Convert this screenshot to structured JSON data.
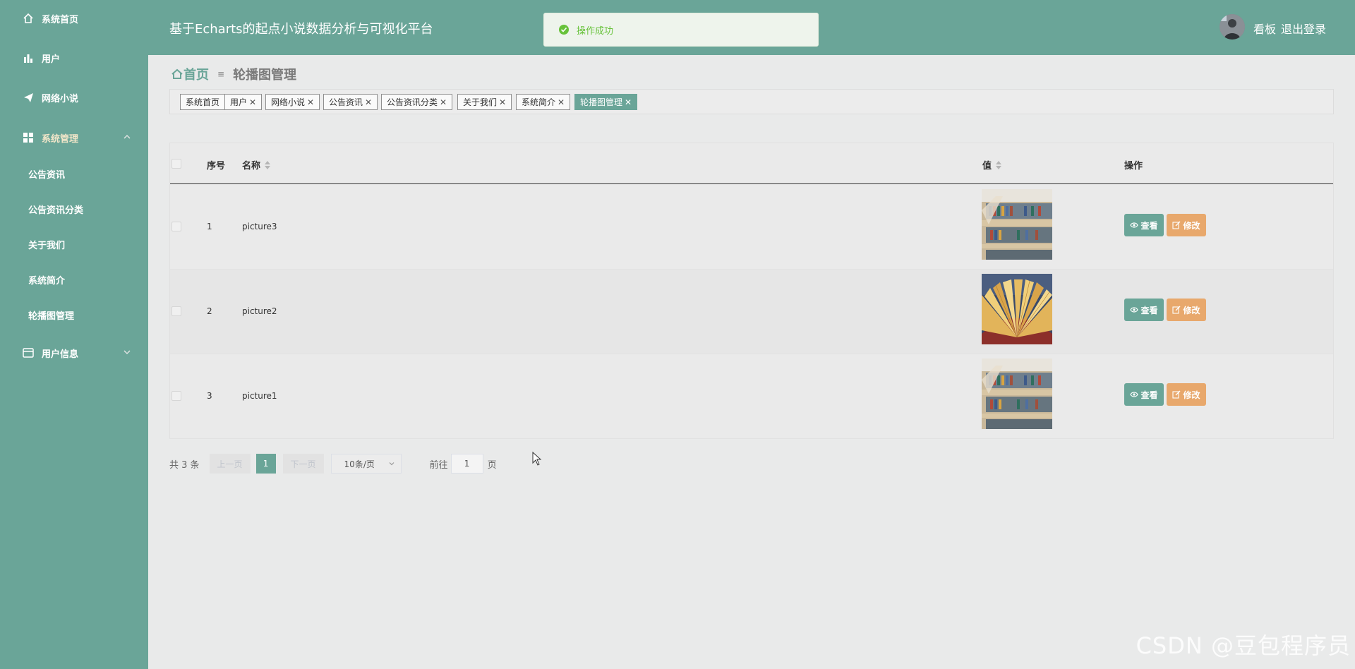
{
  "sidebar": {
    "items": [
      {
        "label": "系统首页",
        "icon": "home-icon"
      },
      {
        "label": "用户",
        "icon": "bar-chart-icon"
      },
      {
        "label": "网络小说",
        "icon": "paper-plane-icon"
      },
      {
        "label": "系统管理",
        "icon": "grid-icon",
        "expanded": true
      },
      {
        "label": "用户信息",
        "icon": "card-icon",
        "expanded": false
      }
    ],
    "submenu": [
      "公告资讯",
      "公告资讯分类",
      "关于我们",
      "系统简介",
      "轮播图管理"
    ]
  },
  "header": {
    "title": "基于Echarts的起点小说数据分析与可视化平台",
    "dashboard_link": "看板",
    "logout_link": "退出登录"
  },
  "toast": {
    "message": "操作成功",
    "icon": "success-circle-icon"
  },
  "breadcrumb": {
    "home": "首页",
    "separator": "≡",
    "current": "轮播图管理"
  },
  "tags": [
    {
      "label": "系统首页",
      "closable": false
    },
    {
      "label": "用户",
      "closable": true
    },
    {
      "label": "网络小说",
      "closable": true
    },
    {
      "label": "公告资讯",
      "closable": true
    },
    {
      "label": "公告资讯分类",
      "closable": true
    },
    {
      "label": "关于我们",
      "closable": true
    },
    {
      "label": "系统简介",
      "closable": true
    },
    {
      "label": "轮播图管理",
      "closable": true,
      "active": true
    }
  ],
  "table": {
    "columns": {
      "index": "序号",
      "name": "名称",
      "value": "值",
      "actions": "操作"
    },
    "rows": [
      {
        "index": "1",
        "name": "picture3",
        "image": "library-shelves"
      },
      {
        "index": "2",
        "name": "picture2",
        "image": "open-book"
      },
      {
        "index": "3",
        "name": "picture1",
        "image": "library-shelves"
      }
    ],
    "view_label": "查看",
    "edit_label": "修改"
  },
  "pager": {
    "total": "共 3 条",
    "prev": "上一页",
    "current_page": "1",
    "next": "下一页",
    "page_size": "10条/页",
    "goto_label": "前往",
    "goto_value": "1",
    "page_suffix": "页"
  },
  "watermark": "CSDN @豆包程序员",
  "colors": {
    "theme": "#6aa598",
    "edit": "#e8a86c",
    "success": "#67c23a"
  }
}
